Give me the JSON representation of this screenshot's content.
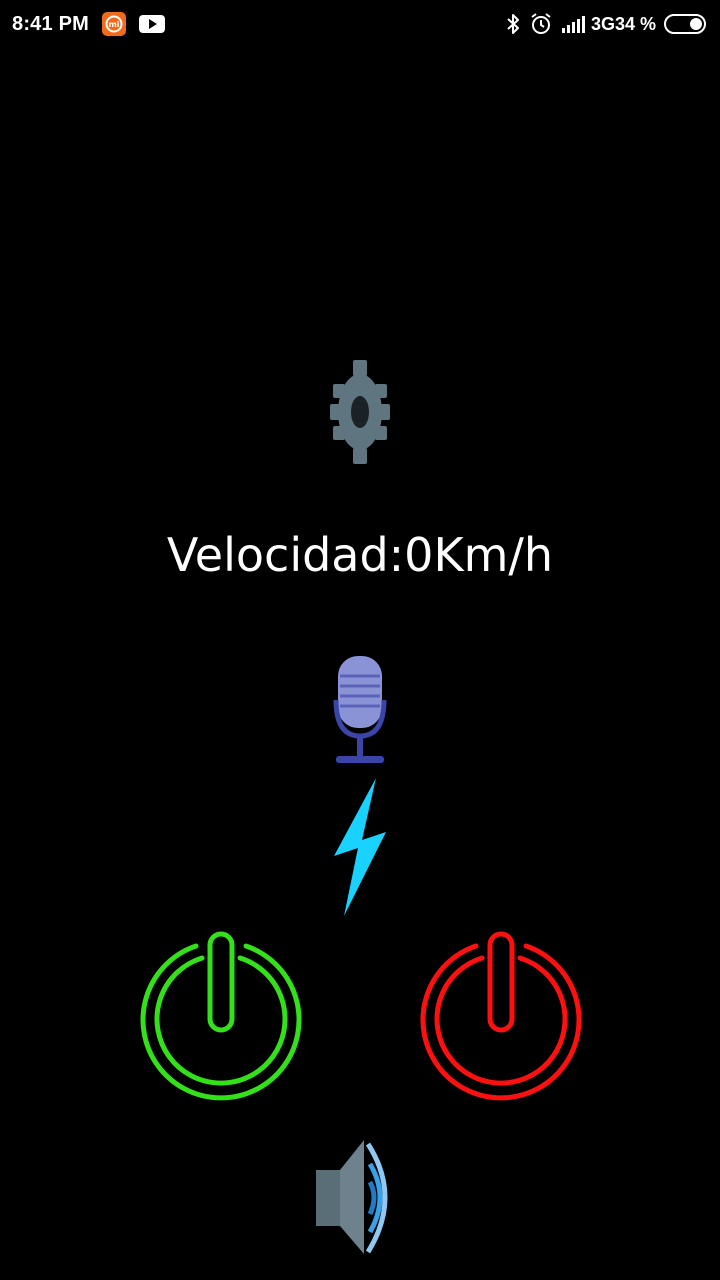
{
  "status_bar": {
    "time": "8:41 PM",
    "network": "3G",
    "battery": "34 %",
    "notification_icons": [
      "mi-app-icon",
      "youtube-icon"
    ],
    "system_icons": [
      "bluetooth-icon",
      "alarm-icon",
      "signal-icon",
      "battery-icon"
    ]
  },
  "main": {
    "settings_icon": "gear-icon",
    "speed_label": "Velocidad:0Km/h",
    "mic_icon": "microphone-icon",
    "bolt_icon": "lightning-icon",
    "power_on_icon": "power-on-icon",
    "power_off_icon": "power-off-icon",
    "speaker_icon": "speaker-icon"
  },
  "colors": {
    "background": "#000000",
    "gear": "#5f7580",
    "mic": "#8a93d6",
    "bolt": "#1ad2ff",
    "power_on": "#33e01a",
    "power_off": "#ff1010",
    "speaker_body": "#5a6e78",
    "speaker_waves": "#3aa0e8"
  }
}
